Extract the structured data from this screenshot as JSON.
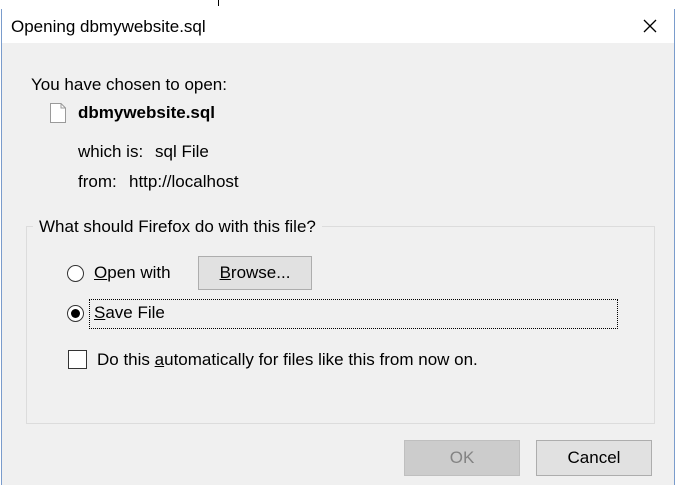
{
  "window": {
    "title": "Opening dbmywebsite.sql"
  },
  "intro": "You have chosen to open:",
  "file": {
    "name": "dbmywebsite.sql",
    "type_label": "which is:",
    "type_value": "sql File",
    "from_label": "from:",
    "from_value": "http://localhost"
  },
  "group": {
    "legend": "What should Firefox do with this file?",
    "open_with": {
      "access_key": "O",
      "label_rest": "pen with",
      "selected": false
    },
    "browse": {
      "access_key": "B",
      "label_rest": "rowse..."
    },
    "save_file": {
      "access_key": "S",
      "label_rest": "ave File",
      "selected": true
    },
    "auto": {
      "label_pre": "Do this ",
      "access_key": "a",
      "label_post": "utomatically for files like this from now on.",
      "checked": false
    }
  },
  "buttons": {
    "ok": "OK",
    "cancel": "Cancel"
  }
}
